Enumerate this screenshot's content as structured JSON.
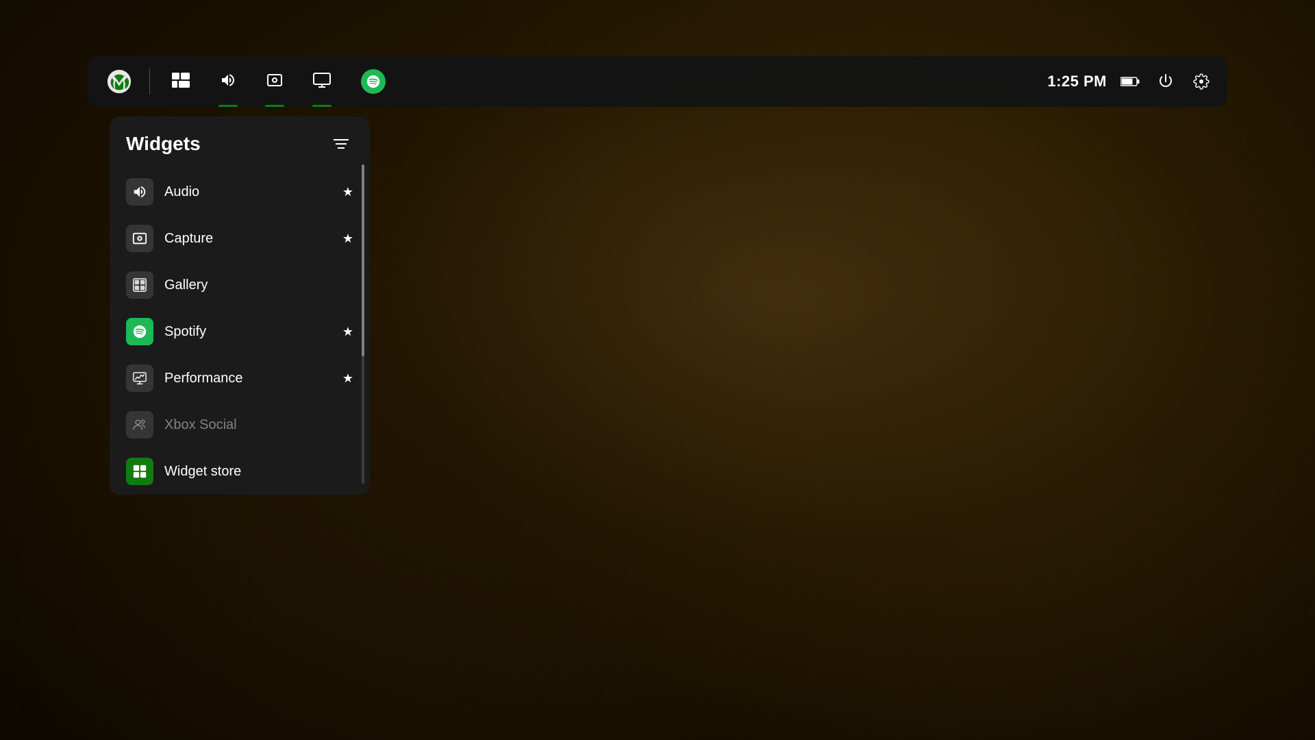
{
  "background": {
    "color": "#1a0f00"
  },
  "topbar": {
    "xbox_logo_alt": "Xbox logo",
    "nav_items": [
      {
        "id": "multiwindow",
        "label": "Multi-window",
        "active": false
      },
      {
        "id": "audio",
        "label": "Audio",
        "active": true
      },
      {
        "id": "capture",
        "label": "Capture",
        "active": true
      },
      {
        "id": "display",
        "label": "Display",
        "active": true
      },
      {
        "id": "spotify",
        "label": "Spotify",
        "active": false
      }
    ],
    "time": "1:25 PM",
    "battery_icon": "🔋",
    "power_icon": "⏻",
    "settings_icon": "⚙"
  },
  "widgets_panel": {
    "title": "Widgets",
    "filter_button_label": "Filter",
    "items": [
      {
        "id": "audio",
        "label": "Audio",
        "has_star": true,
        "starred": true,
        "dim": false
      },
      {
        "id": "capture",
        "label": "Capture",
        "has_star": true,
        "starred": true,
        "dim": false
      },
      {
        "id": "gallery",
        "label": "Gallery",
        "has_star": false,
        "starred": false,
        "dim": false
      },
      {
        "id": "spotify",
        "label": "Spotify",
        "has_star": true,
        "starred": true,
        "dim": false
      },
      {
        "id": "performance",
        "label": "Performance",
        "has_star": true,
        "starred": true,
        "dim": false
      },
      {
        "id": "xbox-social",
        "label": "Xbox Social",
        "has_star": false,
        "starred": false,
        "dim": true
      },
      {
        "id": "widget-store",
        "label": "Widget store",
        "has_star": false,
        "starred": false,
        "dim": false,
        "store": true
      }
    ]
  }
}
